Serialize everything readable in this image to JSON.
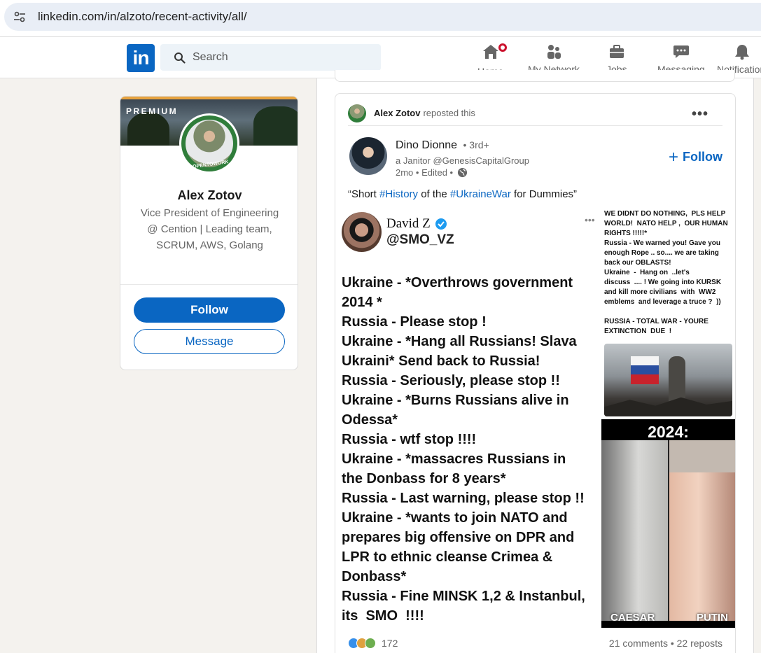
{
  "browser": {
    "url": "linkedin.com/in/alzoto/recent-activity/all/"
  },
  "nav": {
    "search_placeholder": "Search",
    "items": [
      {
        "label": "Home",
        "icon": "home-icon",
        "has_badge": true
      },
      {
        "label": "My Network",
        "icon": "network-icon"
      },
      {
        "label": "Jobs",
        "icon": "briefcase-icon"
      },
      {
        "label": "Messaging",
        "icon": "messaging-icon"
      },
      {
        "label": "Notifications",
        "icon": "bell-icon"
      }
    ]
  },
  "profile": {
    "premium_label": "PREMIUM",
    "badge": "#OPENTOWORK",
    "name": "Alex Zotov",
    "headline": "Vice President of Engineering @ Cention | Leading team, SCRUM, AWS, Golang",
    "follow_label": "Follow",
    "message_label": "Message"
  },
  "post": {
    "reposter": "Alex Zotov",
    "repost_verb": "reposted this",
    "menu_label": "•••",
    "author": {
      "name": "Dino Dionne",
      "degree": "• 3rd+",
      "headline": "a Janitor @GenesisCapitalGroup",
      "meta": "2mo • Edited •"
    },
    "follow_label": "Follow",
    "caption": {
      "open": "“Short ",
      "tag1": "#History",
      "mid": " of the ",
      "tag2": "#UkraineWar",
      "close": " for Dummies”"
    },
    "media": {
      "tweet_name": "David Z",
      "tweet_handle": "@SMO_VZ",
      "tweet_menu": "•••",
      "tweet_lines": [
        "Ukraine - *Overthrows government\n2014 *",
        "Russia - Please stop !",
        "Ukraine - *Hang all Russians! Slava\nUkraini* Send back to Russia!",
        "Russia - Seriously, please stop !!",
        "Ukraine - *Burns Russians alive in\nOdessa*",
        "Russia - wtf stop !!!!",
        "Ukraine - *massacres Russians in\nthe Donbass for 8 years*",
        "Russia - Last warning, please stop !!",
        "Ukraine - *wants to join NATO and\nprepares big offensive on DPR and\nLPR to ethnic cleanse Crimea &\nDonbass*",
        "Russia - Fine MINSK 1,2 & Instanbul,\nits  SMO  !!!!"
      ],
      "side_text": [
        "WE DIDNT DO NOTHING,  PLS HELP\nWORLD!  NATO HELP ,  OUR HUMAN\nRIGHTS !!!!!*",
        "Russia - We warned you! Gave you\nenough Rope .. so.... we are taking\nback our OBLASTS!",
        "Ukraine  -  Hang on  ..let's\ndiscuss  .... ! We going into KURSK\nand kill more civilians  with  WW2\nemblems  and leverage a truce ?  ))",
        "",
        "RUSSIA - TOTAL WAR - YOURE\nEXTINCTION  DUE  !"
      ],
      "meme_year": "2024:",
      "meme_left": "CAESAR",
      "meme_right": "PUTIN"
    },
    "reactions_count": "172",
    "comments_reposts": "21 comments • 22 reposts"
  },
  "colors": {
    "brand": "#0a66c2",
    "premium": "#e7a33e",
    "badge": "#cb112d"
  }
}
